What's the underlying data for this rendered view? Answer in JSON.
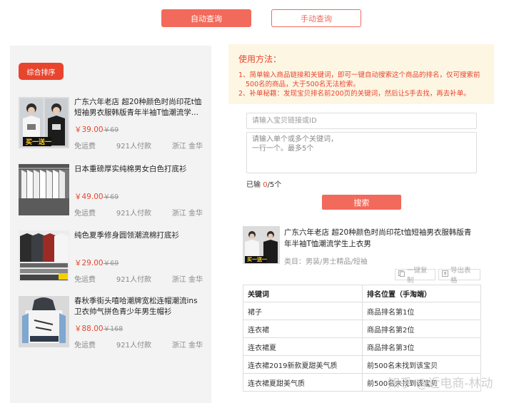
{
  "top_buttons": {
    "auto": "自动查询",
    "manual": "手动查询"
  },
  "left": {
    "sort_label": "综合排序",
    "items": [
      {
        "title": "广东六年老店 超20种颜色时尚印花t恤短袖男衣服韩版青年半袖T恤潮流学...",
        "price": "￥39.00",
        "old_price": "￥69",
        "shipping": "免运费",
        "buyers": "921人付款",
        "location": "浙江 金华",
        "badge": "买一送一"
      },
      {
        "title": "日本重磅厚实纯棉男女白色打底衫",
        "price": "￥49.00",
        "old_price": "￥69",
        "shipping": "免运费",
        "buyers": "921人付款",
        "location": "浙江 金华"
      },
      {
        "title": "纯色夏季修身圆领潮流棉打底衫",
        "price": "￥29.00",
        "old_price": "￥69",
        "shipping": "免运费",
        "buyers": "921人付款",
        "location": "浙江 金华"
      },
      {
        "title": "春秋季街头嘻哈潮牌宽松连帽潮流ins卫衣帅气拼色青少年男生帽衫",
        "price": "￥88.00",
        "old_price": "￥168",
        "shipping": "免运费",
        "buyers": "921人付款",
        "location": "浙江 金华"
      }
    ]
  },
  "howto": {
    "title": "使用方法：",
    "lines": [
      "1、简单输入商品链接和关键词，即可一键自动搜索这个商品的排名，仅可搜索前",
      "500名的商品，大于500名无法检索。",
      "2、补单秘籍：发现宝贝排名前200页的关键词，然后让S手去找，再去补单。"
    ]
  },
  "form": {
    "link_placeholder": "请输入宝贝链接或ID",
    "keywords_placeholder": "请输入单个或多个关键词，\n一行一个。最多5个",
    "count_prefix": "已输 ",
    "count_value": "0",
    "count_suffix": "/5个",
    "search_label": "搜索"
  },
  "result": {
    "title": "广东六年老店 超20种颜色时尚印花t恤短袖男衣服韩版青年半袖T恤潮流学生上衣男",
    "category": "类目：男装/男士精品/短袖",
    "copy_label": "一键复制",
    "export_label": "导出表格",
    "badge": "买一送一"
  },
  "table": {
    "headers": [
      "关键词",
      "排名位置（手淘端）"
    ],
    "rows": [
      [
        "裙子",
        "商品排名第1位"
      ],
      [
        "连衣裙",
        "商品排名第2位"
      ],
      [
        "连衣裙夏",
        "商品排名第3位"
      ],
      [
        "连衣裙2019新款夏甜美气质",
        "前500名未找到该宝贝"
      ],
      [
        "连衣裙夏甜美气质",
        "前500名未找到该宝贝"
      ]
    ]
  },
  "watermark": "知乎 @近电商-林动",
  "colors": {
    "accent": "#f26a5b",
    "sort_red": "#e8452e",
    "howto_bg": "#fdf6e3",
    "panel_bg": "#f3f3f3"
  }
}
